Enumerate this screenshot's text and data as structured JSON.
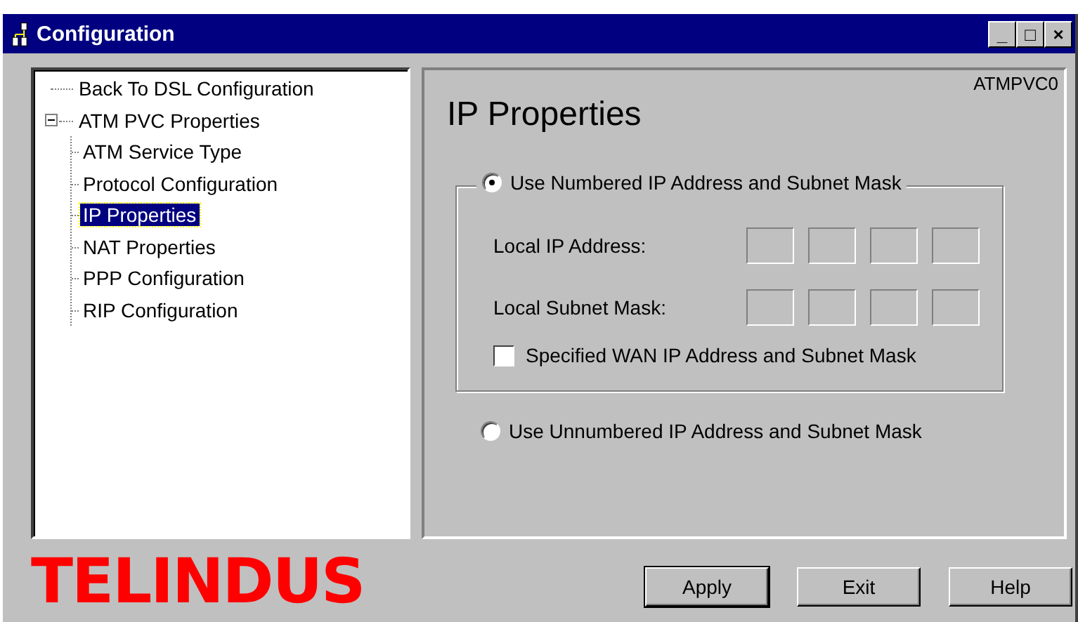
{
  "window": {
    "title": "Configuration",
    "controls": [
      "_",
      "□",
      "×"
    ]
  },
  "tree": [
    {
      "label": "Back To DSL Configuration",
      "selected": false
    },
    {
      "label": "ATM PVC Properties",
      "selected": false,
      "expanded": true,
      "children": [
        {
          "label": "ATM Service Type",
          "selected": false
        },
        {
          "label": "Protocol Configuration",
          "selected": false
        },
        {
          "label": "IP Properties",
          "selected": true
        },
        {
          "label": "NAT Properties",
          "selected": false
        },
        {
          "label": "PPP Configuration",
          "selected": false
        },
        {
          "label": "RIP Configuration",
          "selected": false
        }
      ]
    }
  ],
  "panel": {
    "tag": "ATMPVC0",
    "heading": "IP Properties",
    "numbered": {
      "label": "Use Numbered IP Address and Subnet Mask",
      "selected": true
    },
    "fields": [
      {
        "label": "Local IP Address:"
      },
      {
        "label": "Local Subnet Mask:"
      }
    ],
    "wan_checkbox": {
      "label": "Specified WAN IP Address and Subnet Mask",
      "checked": false
    },
    "unnumbered": {
      "label": "Use Unnumbered IP Address and Subnet Mask",
      "selected": false
    }
  },
  "logo": "TELINDUS",
  "buttons": [
    {
      "label": "Apply",
      "default": true
    },
    {
      "label": "Exit",
      "default": false
    },
    {
      "label": "Help",
      "default": false
    }
  ]
}
